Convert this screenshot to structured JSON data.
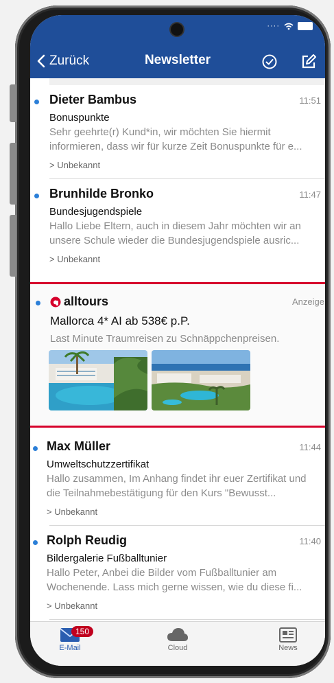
{
  "header": {
    "back_label": "Zurück",
    "title": "Newsletter"
  },
  "mails": [
    {
      "sender": "Dieter Bambus",
      "time": "11:51",
      "subject": "Bonuspunkte",
      "preview": "Sehr geehrte(r) Kund*in, wir möchten Sie hiermit informieren, dass wir für kurze Zeit Bonuspunkte für e...",
      "folder": "> Unbekannt"
    },
    {
      "sender": "Brunhilde Bronko",
      "time": "11:47",
      "subject": "Bundesjugendspiele",
      "preview": "Hallo Liebe Eltern, auch in diesem Jahr möchten wir an unsere Schule wieder die Bundesjugendspiele ausric...",
      "folder": "> Unbekannt"
    },
    {
      "sender": "Max Müller",
      "time": "11:44",
      "subject": "Umweltschutzzertifikat",
      "preview": "Hallo zusammen, Im Anhang findet ihr euer Zertifikat und die Teilnahmebestätigung für den Kurs \"Bewusst...",
      "folder": "> Unbekannt"
    },
    {
      "sender": "Rolph Reudig",
      "time": "11:40",
      "subject": "Bildergalerie Fußballtunier",
      "preview": "Hallo Peter, Anbei die Bilder vom Fußballtunier am Wochenende. Lass mich gerne wissen, wie du diese fi...",
      "folder": "> Unbekannt"
    }
  ],
  "ad": {
    "brand": "alltours",
    "label": "Anzeige",
    "title": "Mallorca 4* AI ab 538€ p.P.",
    "text": "Last Minute Traumreisen zu Schnäppchenpreisen."
  },
  "tabs": {
    "email_label": "E-Mail",
    "email_badge": "150",
    "cloud_label": "Cloud",
    "news_label": "News"
  },
  "colors": {
    "header": "#1f4e99",
    "unread_dot": "#2b7fd8",
    "ad_highlight": "#d6002b",
    "badge": "#c0001e"
  }
}
